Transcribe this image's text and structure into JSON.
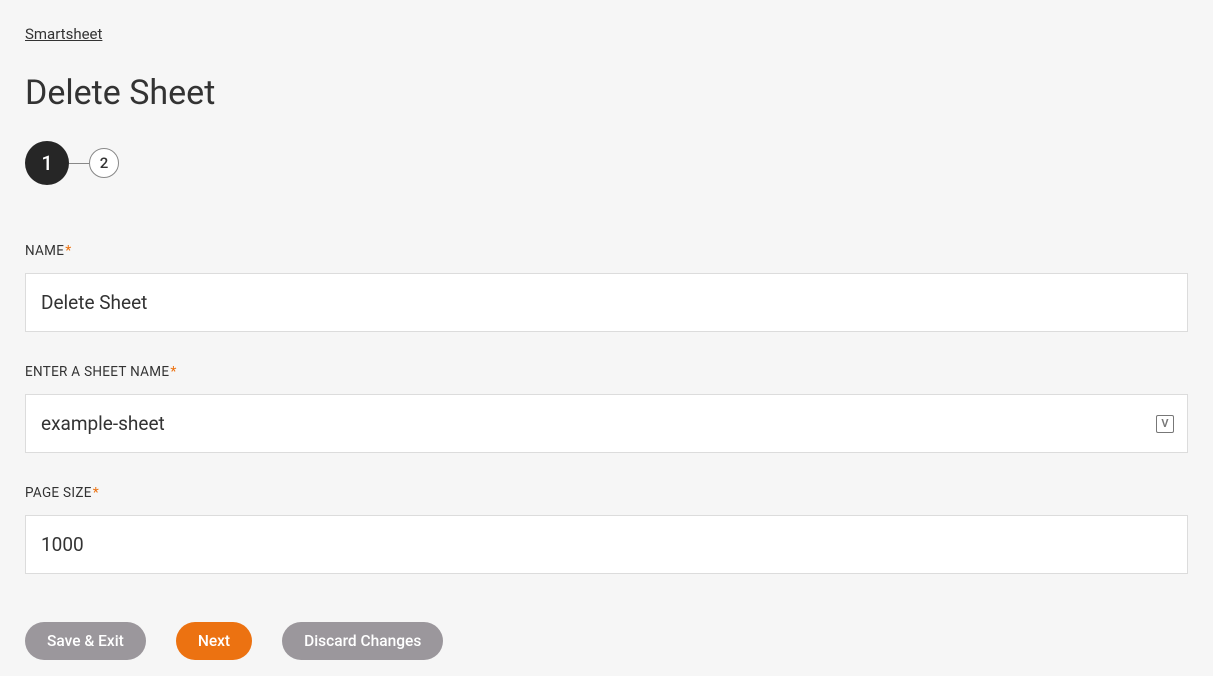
{
  "breadcrumb": "Smartsheet",
  "title": "Delete Sheet",
  "stepper": {
    "current": "1",
    "next": "2"
  },
  "fields": {
    "name": {
      "label": "NAME",
      "value": "Delete Sheet"
    },
    "sheet_name": {
      "label": "ENTER A SHEET NAME",
      "value": "example-sheet"
    },
    "page_size": {
      "label": "PAGE SIZE",
      "value": "1000"
    }
  },
  "var_icon_glyph": "V",
  "buttons": {
    "save_exit": "Save & Exit",
    "next": "Next",
    "discard": "Discard Changes"
  },
  "required_marker": "*"
}
